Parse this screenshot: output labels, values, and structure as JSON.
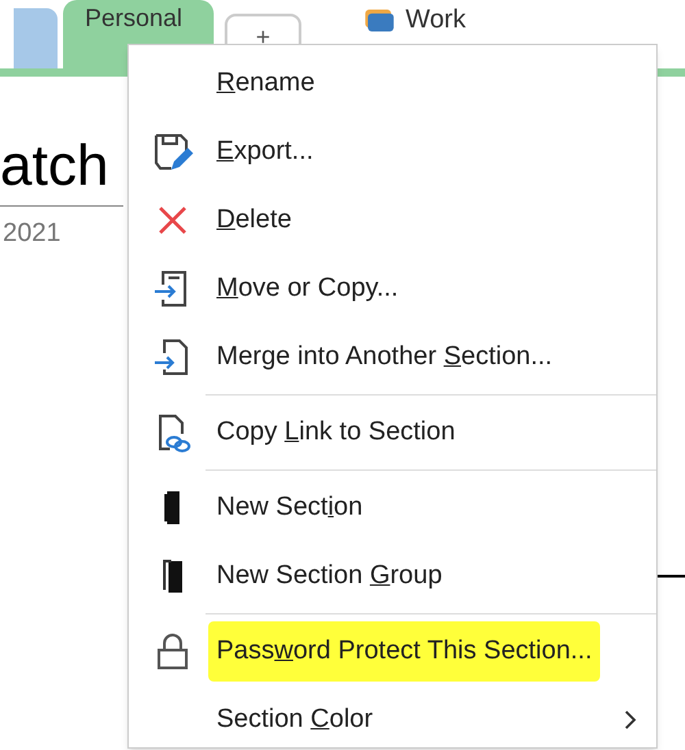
{
  "tabs": [
    {
      "color": "#9cc2e5",
      "selected": false
    },
    {
      "label": "Personal",
      "color": "#8fd19e",
      "selected": true
    }
  ],
  "add_tab": {
    "label": "+"
  },
  "notebook_link": {
    "label": "Work"
  },
  "page": {
    "title": "atch",
    "date": "2021"
  },
  "context_menu": {
    "items": [
      {
        "key": "R",
        "after": "ename",
        "divider_after": false,
        "highlighted": false
      },
      {
        "key": "E",
        "after": "xport...",
        "divider_after": false,
        "highlighted": false
      },
      {
        "key": "D",
        "after": "elete",
        "divider_after": false,
        "highlighted": false
      },
      {
        "key": "M",
        "after": "ove or Copy...",
        "divider_after": false,
        "highlighted": false
      },
      {
        "before": "Merge into Another ",
        "key": "S",
        "after": "ection...",
        "divider_after": true,
        "highlighted": false
      },
      {
        "before": "Copy ",
        "key": "L",
        "after": "ink to Section",
        "divider_after": true,
        "highlighted": false
      },
      {
        "before": "New Sect",
        "key": "i",
        "after": "on",
        "divider_after": false,
        "highlighted": false
      },
      {
        "before": "New Section ",
        "key": "G",
        "after": "roup",
        "divider_after": true,
        "highlighted": false
      },
      {
        "before": "Pass",
        "key": "w",
        "after": "ord Protect This Section...",
        "divider_after": false,
        "highlighted": true
      },
      {
        "before": "Section ",
        "key": "C",
        "after": "olor",
        "divider_after": false,
        "highlighted": false,
        "submenu": true
      }
    ]
  }
}
